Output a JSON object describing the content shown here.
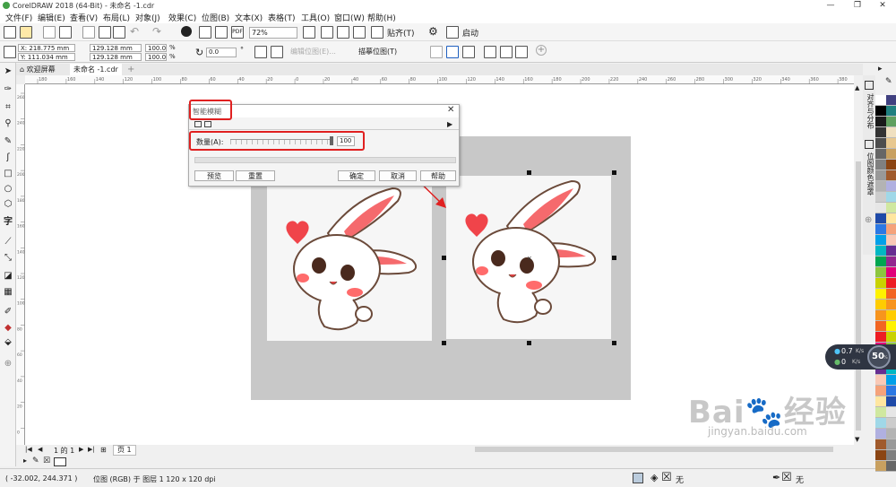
{
  "app": {
    "title": "CorelDRAW 2018 (64-Bit) - 未命名 -1.cdr",
    "window_controls": [
      "—",
      "❐",
      "✕"
    ]
  },
  "menu": [
    "文件(F)",
    "编辑(E)",
    "查看(V)",
    "布局(L)",
    "对象(J)",
    "效果(C)",
    "位图(B)",
    "文本(X)",
    "表格(T)",
    "工具(O)",
    "窗口(W)",
    "帮助(H)"
  ],
  "toolbar": {
    "zoom": "72%",
    "snap_label": "贴齐(T)",
    "launch_label": "启动"
  },
  "property_bar": {
    "x": "X: 218.775 mm",
    "y": "Y: 111.034 mm",
    "width": "129.128 mm",
    "height": "129.128 mm",
    "scale_w": "100.0",
    "scale_h": "100.0",
    "pct": "%",
    "angle": "0.0",
    "degree": "°",
    "edit_bitmap": "编辑位图(E)...",
    "trace_bitmap": "描摹位图(T)"
  },
  "tabs": {
    "welcome": "欢迎屏幕",
    "document": "未命名 -1.cdr",
    "add": "+"
  },
  "ruler": {
    "h_ticks": [
      "180",
      "160",
      "140",
      "120",
      "100",
      "80",
      "60",
      "40",
      "20",
      "0",
      "20",
      "40",
      "60",
      "80",
      "100",
      "120",
      "140",
      "160",
      "180",
      "200",
      "220",
      "240",
      "260",
      "280",
      "300",
      "320",
      "340",
      "360",
      "380"
    ],
    "v_ticks": [
      "260",
      "240",
      "220",
      "200",
      "180",
      "160",
      "140",
      "120",
      "100",
      "80",
      "60",
      "40",
      "20",
      "0"
    ],
    "unit": "毫米"
  },
  "dialog": {
    "title": "智能模糊",
    "amount_label": "数量(A):",
    "amount_value": "100",
    "amount_level": 1.0,
    "buttons": {
      "preview": "预览",
      "reset": "重置",
      "ok": "确定",
      "cancel": "取消",
      "help": "帮助"
    }
  },
  "pagebar": {
    "counter": "1 的 1",
    "page_tab": "页 1"
  },
  "status": {
    "coords": "( -32.002, 244.371 )",
    "object_info": "位图 (RGB) 于 图层 1 120 x 120 dpi",
    "fill_none": "无",
    "outline_none": "无"
  },
  "dockers": {
    "tab1": "对齐与分布",
    "tab2": "位图颜色遮罩"
  },
  "net_widget": {
    "up": "0.7",
    "down": "0",
    "unit": "K/s",
    "percent": "50",
    "percent_sign": "%"
  },
  "watermark": {
    "brand": "Bai",
    "brand_cn": "经验",
    "url": "jingyan.baidu.com"
  },
  "colors": {
    "accent_red": "#e02020",
    "workspace_gray": "#c8c8c8",
    "palette": [
      "#ffffff",
      "#000000",
      "#1a1a1a",
      "#333333",
      "#4d4d4d",
      "#666666",
      "#808080",
      "#999999",
      "#b3b3b3",
      "#cccccc",
      "#e6e6e6",
      "#1f4aa8",
      "#2b78e4",
      "#00a0e9",
      "#00b7c3",
      "#00a651",
      "#8dc63f",
      "#c9d200",
      "#fff200",
      "#ffcc00",
      "#f7941d",
      "#f26522",
      "#ed1c24",
      "#e0007a",
      "#92278f",
      "#662d91",
      "#f9c9b6",
      "#f5a27a",
      "#ffe6a0",
      "#d0e8a0",
      "#a0d8e8",
      "#b0b0e0",
      "#a05a2c",
      "#8b4513",
      "#c8a060",
      "#e8c890",
      "#f0e0c0",
      "#60a060",
      "#208080",
      "#404080"
    ]
  }
}
